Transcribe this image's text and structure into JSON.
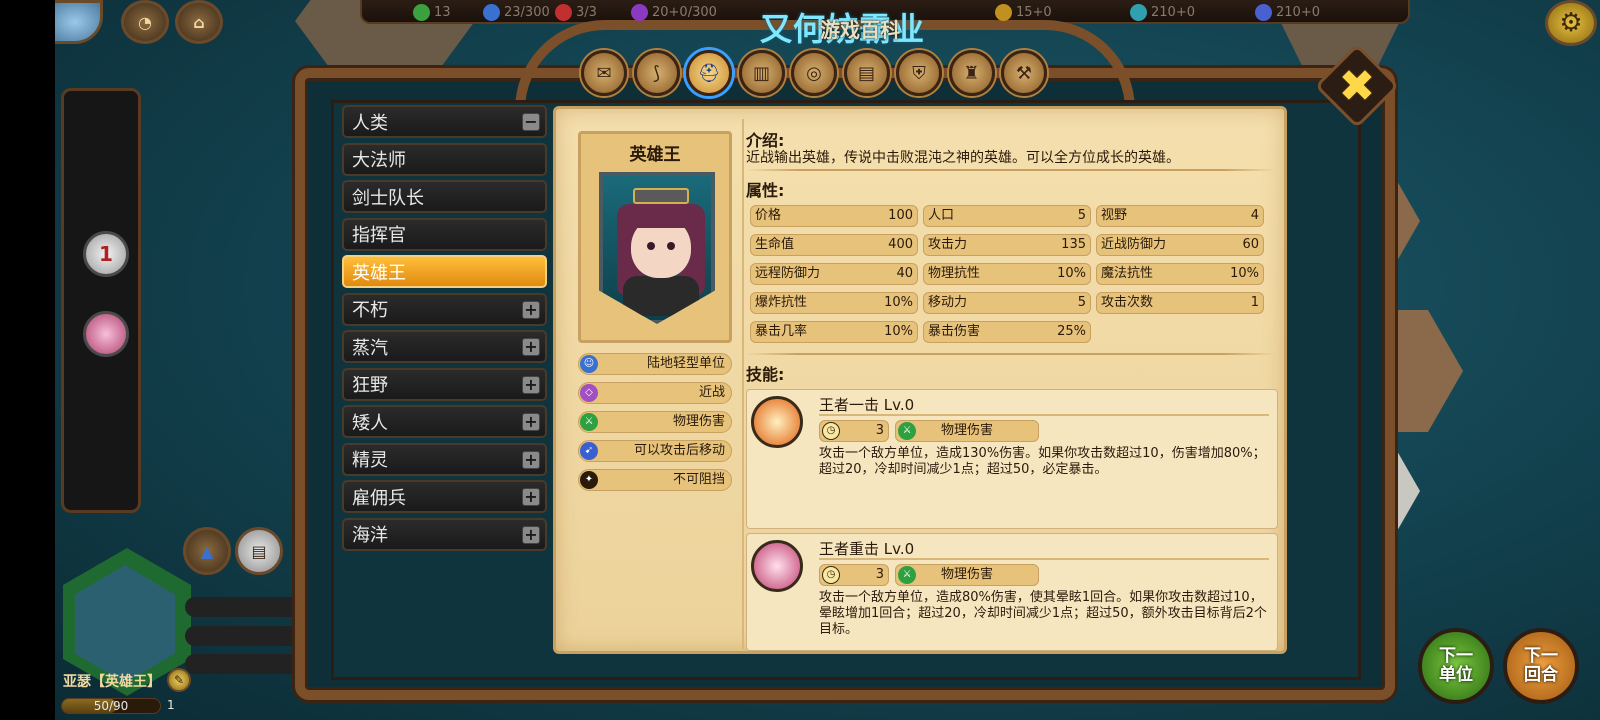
{
  "overlay": {
    "title_cyan": "又何妨霸业",
    "title_white": "游戏百科"
  },
  "resources": [
    {
      "icon": "leaf-icon",
      "value": "13",
      "color": "#3aa040"
    },
    {
      "icon": "population-icon",
      "value": "23/300",
      "color": "#3a70d0"
    },
    {
      "icon": "unit-cap-icon",
      "value": "3/3",
      "color": "#c03030"
    },
    {
      "icon": "magic-icon",
      "value": "20+0/300",
      "color": "#8a3ac0"
    },
    {
      "icon": "gold-icon",
      "value": "15+0",
      "color": "#c09020"
    },
    {
      "icon": "crystal-icon",
      "value": "210+0",
      "color": "#30a0b0"
    },
    {
      "icon": "mana-icon",
      "value": "210+0",
      "color": "#4a60d0"
    }
  ],
  "left_panel": {
    "badge_number": "1"
  },
  "category_tabs": [
    {
      "icon": "scroll-icon"
    },
    {
      "icon": "claw-icon"
    },
    {
      "icon": "helmet-icon",
      "active": true
    },
    {
      "icon": "armor-icon"
    },
    {
      "icon": "swirl-icon"
    },
    {
      "icon": "book-icon"
    },
    {
      "icon": "shield-icon"
    },
    {
      "icon": "tower-icon"
    },
    {
      "icon": "hammer-icon"
    }
  ],
  "races": [
    {
      "label": "人类",
      "toggle": "−"
    },
    {
      "label": "大法师"
    },
    {
      "label": "剑士队长"
    },
    {
      "label": "指挥官"
    },
    {
      "label": "英雄王",
      "active": true
    },
    {
      "label": "不朽",
      "toggle": "+"
    },
    {
      "label": "蒸汽",
      "toggle": "+"
    },
    {
      "label": "狂野",
      "toggle": "+"
    },
    {
      "label": "矮人",
      "toggle": "+"
    },
    {
      "label": "精灵",
      "toggle": "+"
    },
    {
      "label": "雇佣兵",
      "toggle": "+"
    },
    {
      "label": "海洋",
      "toggle": "+"
    }
  ],
  "hero": {
    "name": "英雄王",
    "tags": [
      {
        "label": "陆地轻型单位",
        "icon": "unit-type-icon",
        "color": "#3a70d0"
      },
      {
        "label": "近战",
        "icon": "melee-icon",
        "color": "#a050c0"
      },
      {
        "label": "物理伤害",
        "icon": "physical-damage-icon",
        "color": "#2fa040"
      },
      {
        "label": "可以攻击后移动",
        "icon": "move-after-attack-icon",
        "color": "#3a60d0"
      },
      {
        "label": "不可阻挡",
        "icon": "unstoppable-icon",
        "color": "#2a1a0a"
      }
    ],
    "intro_heading": "介绍:",
    "intro_text": "近战输出英雄，传说中击败混沌之神的英雄。可以全方位成长的英雄。",
    "attr_heading": "属性:",
    "stats": [
      {
        "label": "价格",
        "value": "100"
      },
      {
        "label": "人口",
        "value": "5"
      },
      {
        "label": "视野",
        "value": "4"
      },
      {
        "label": "生命值",
        "value": "400"
      },
      {
        "label": "攻击力",
        "value": "135"
      },
      {
        "label": "近战防御力",
        "value": "60"
      },
      {
        "label": "远程防御力",
        "value": "40"
      },
      {
        "label": "物理抗性",
        "value": "10%"
      },
      {
        "label": "魔法抗性",
        "value": "10%"
      },
      {
        "label": "爆炸抗性",
        "value": "10%"
      },
      {
        "label": "移动力",
        "value": "5"
      },
      {
        "label": "攻击次数",
        "value": "1"
      },
      {
        "label": "暴击几率",
        "value": "10%"
      },
      {
        "label": "暴击伤害",
        "value": "25%"
      }
    ],
    "skills_heading": "技能:",
    "skills": [
      {
        "title": "王者一击 Lv.0",
        "cooldown": "3",
        "damage_type": "物理伤害",
        "icon": "strike-skill-icon",
        "desc": "攻击一个敌方单位，造成130%伤害。如果你攻击数超过10，伤害增加80%；超过20，冷却时间减少1点；超过50，必定暴击。"
      },
      {
        "title": "王者重击 Lv.0",
        "cooldown": "3",
        "damage_type": "物理伤害",
        "icon": "heavy-strike-skill-icon",
        "desc": "攻击一个敌方单位，造成80%伤害，使其晕眩1回合。如果你攻击数超过10，晕眩增加1回合；超过20，冷却时间减少1点；超过50，额外攻击目标背后2个目标。"
      }
    ]
  },
  "unit_panel": {
    "name": "亚瑟【英雄王】",
    "hp_text": "50/90",
    "hp_fraction": 0.56,
    "level": "1"
  },
  "buttons": {
    "next_unit": "下一\n单位",
    "next_turn": "下一\n回合",
    "close": "✖"
  }
}
